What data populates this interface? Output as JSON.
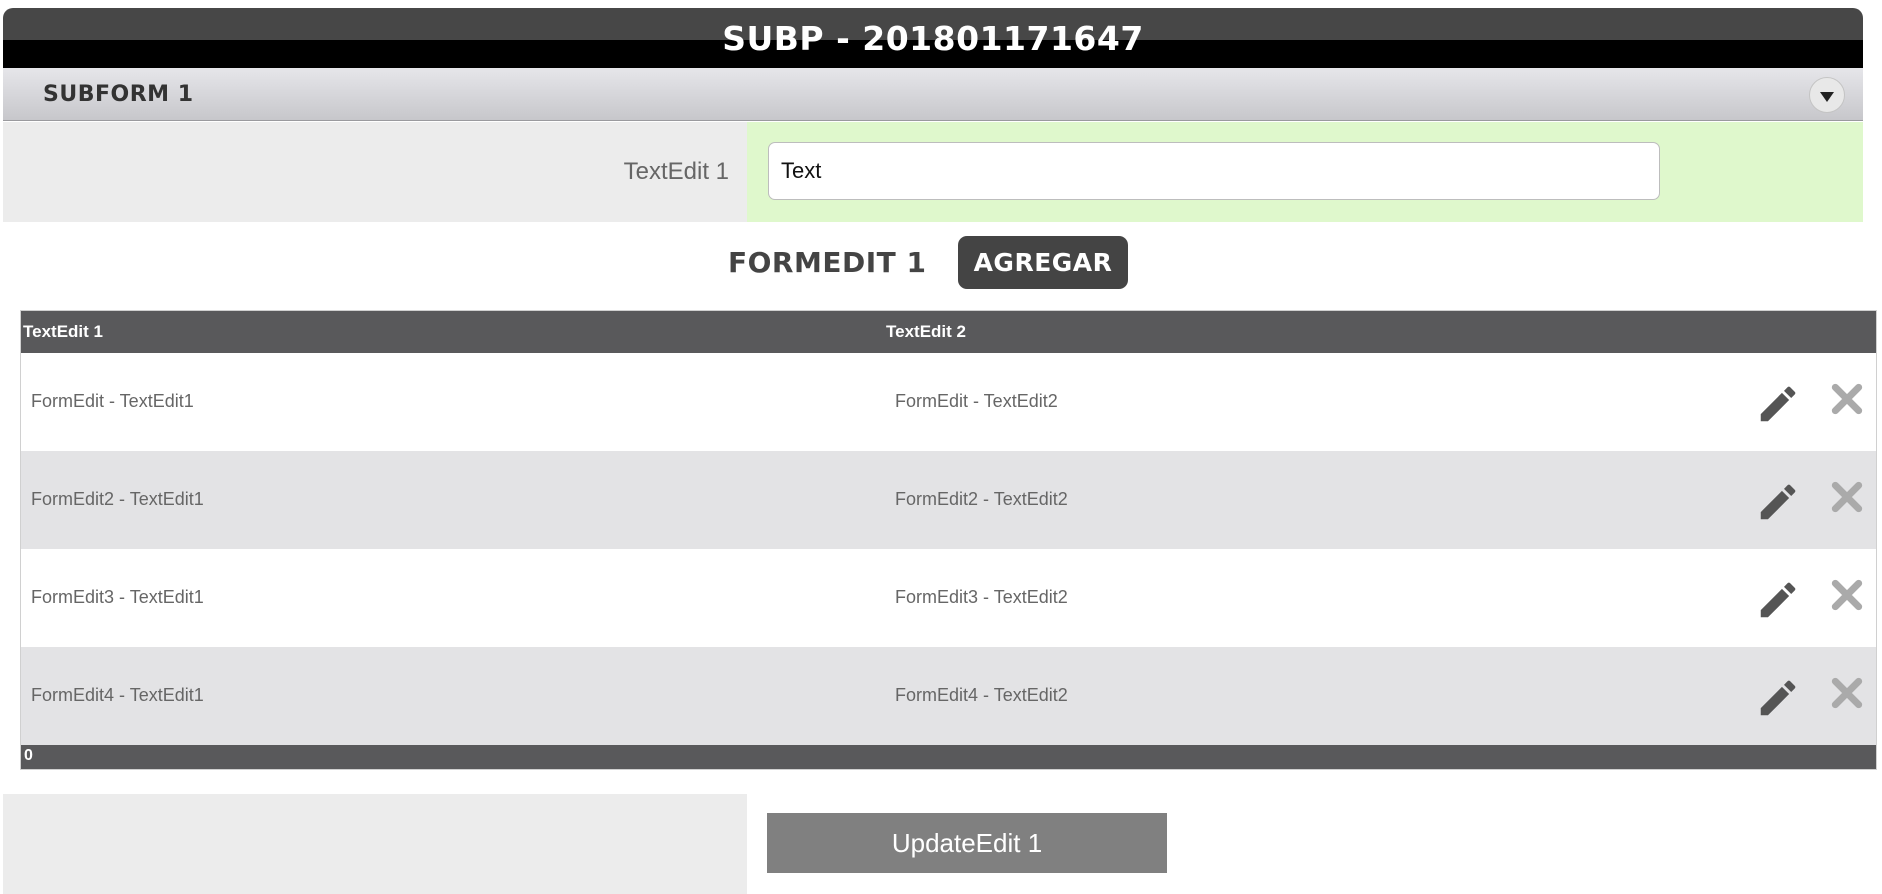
{
  "window": {
    "title": "SUBP - 201801171647"
  },
  "subform": {
    "label": "SUBFORM 1",
    "collapse_icon": "chevron-down-icon"
  },
  "field": {
    "label": "TextEdit 1",
    "value": "Text"
  },
  "formedit": {
    "title": "FORMEDIT 1",
    "add_label": "AGREGAR"
  },
  "grid": {
    "columns": [
      "TextEdit 1",
      "TextEdit 2"
    ],
    "rows": [
      [
        "FormEdit - TextEdit1",
        "FormEdit - TextEdit2"
      ],
      [
        "FormEdit2 - TextEdit1",
        "FormEdit2 - TextEdit2"
      ],
      [
        "FormEdit3 - TextEdit1",
        "FormEdit3 - TextEdit2"
      ],
      [
        "FormEdit4 - TextEdit1",
        "FormEdit4 - TextEdit2"
      ]
    ],
    "row_actions": [
      "pencil-icon",
      "close-icon"
    ],
    "footer": "0"
  },
  "update": {
    "label": "UpdateEdit 1"
  },
  "colors": {
    "header_dark": "#474747",
    "grid_header": "#59595b",
    "input_cell": "#dff8cc",
    "label_cell": "#ececec",
    "row_alt": "#e3e3e5",
    "button": "#444444",
    "update_button": "#808080"
  }
}
